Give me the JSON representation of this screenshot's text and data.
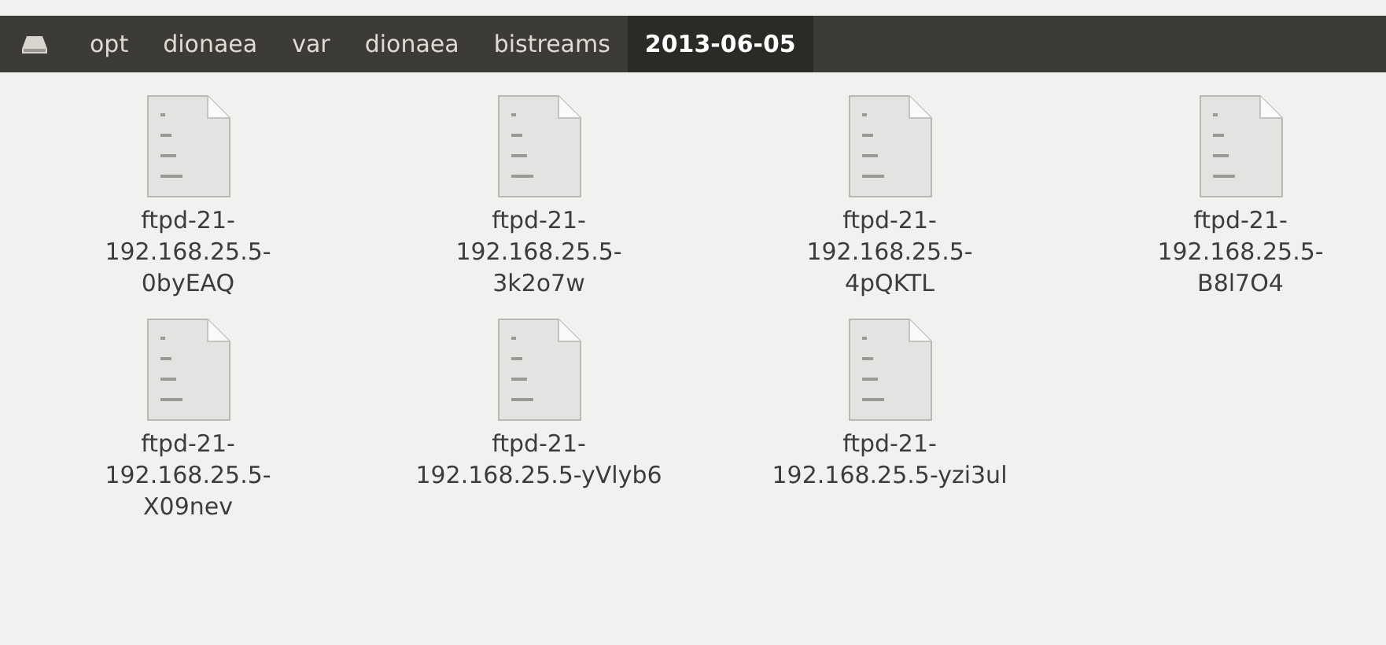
{
  "breadcrumbs": [
    {
      "label": "opt",
      "selected": false
    },
    {
      "label": "dionaea",
      "selected": false
    },
    {
      "label": "var",
      "selected": false
    },
    {
      "label": "dionaea",
      "selected": false
    },
    {
      "label": "bistreams",
      "selected": false
    },
    {
      "label": "2013-06-05",
      "selected": true
    }
  ],
  "files": [
    {
      "name": "ftpd-21-\n192.168.25.5-\n0byEAQ"
    },
    {
      "name": "ftpd-21-\n192.168.25.5-\n3k2o7w"
    },
    {
      "name": "ftpd-21-\n192.168.25.5-\n4pQKTL"
    },
    {
      "name": "ftpd-21-\n192.168.25.5-\nB8l7O4"
    },
    {
      "name": "ftpd-21-\n192.168.25.5-\nX09nev"
    },
    {
      "name": "ftpd-21-\n192.168.25.5-yVlyb6"
    },
    {
      "name": "ftpd-21-\n192.168.25.5-yzi3ul"
    }
  ]
}
